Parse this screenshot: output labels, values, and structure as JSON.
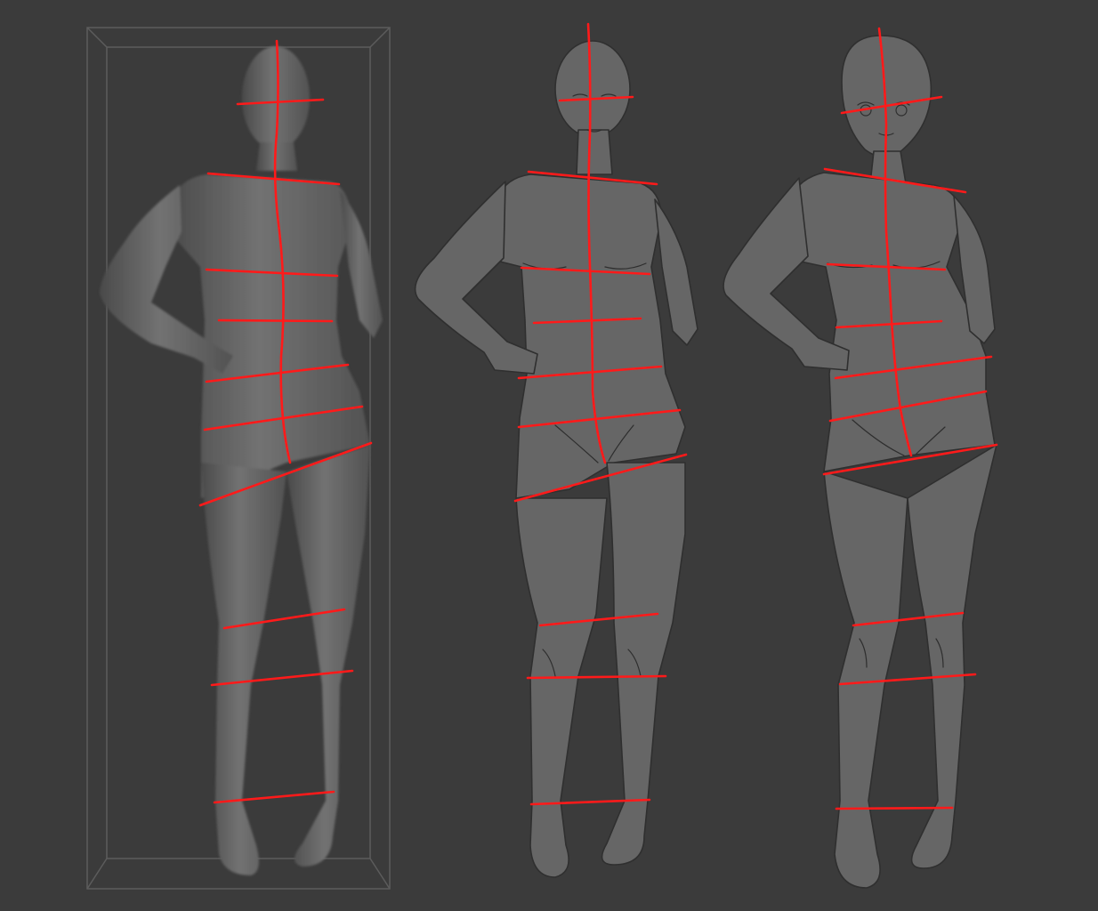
{
  "canvas": {
    "background": "#3b3b3b"
  },
  "colors": {
    "guide": "#ff1a1a",
    "figure_fill": "#666666",
    "figure_outline": "#2f2f2f",
    "bounding_box": "#5c5c5c"
  },
  "figures": [
    {
      "style": "3d-render",
      "has_bounding_box": true,
      "guide_line_count": 11
    },
    {
      "style": "lineart-semi-realistic",
      "has_bounding_box": false,
      "guide_line_count": 11
    },
    {
      "style": "lineart-anime",
      "has_bounding_box": false,
      "guide_line_count": 11
    }
  ]
}
